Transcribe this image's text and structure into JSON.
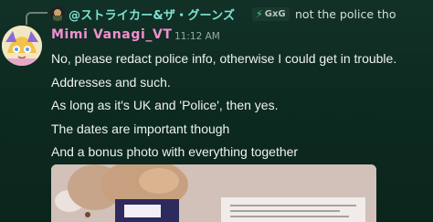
{
  "reply": {
    "author": "@ストライカー&ザ・グーンズ",
    "tag": "GxG",
    "text": "not the police tho"
  },
  "message": {
    "author": "Mimi Vanagi_VT",
    "time": "11:12 AM",
    "lines": [
      "No, please redact police info, otherwise I could get in trouble.",
      "Addresses and such.",
      "As long as it's UK and 'Police', then yes.",
      "The dates are important though",
      "And a bonus photo with everything together"
    ]
  },
  "icons": {
    "reply_avatar": "reply-avatar-image",
    "tag": "lightning-icon",
    "author_avatar": "avatar-image"
  },
  "colors": {
    "background": "#0d2a20",
    "reply_name": "#7fe3d4",
    "author_name": "#f28fd0",
    "tag_bolt": "#3ddc84"
  }
}
